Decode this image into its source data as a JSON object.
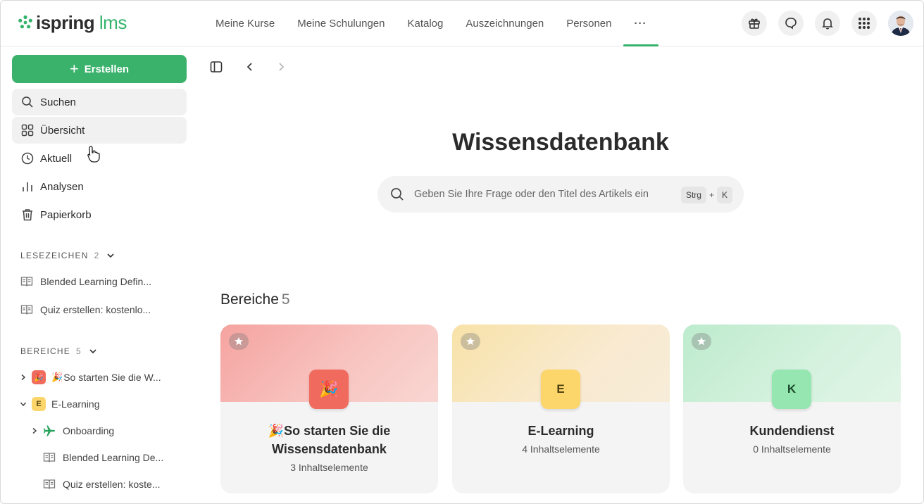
{
  "brand": {
    "name": "ispring",
    "suffix": "lms",
    "color": "#34b36b"
  },
  "nav": {
    "items": [
      {
        "label": "Meine Kurse"
      },
      {
        "label": "Meine Schulungen"
      },
      {
        "label": "Katalog"
      },
      {
        "label": "Auszeichnungen"
      },
      {
        "label": "Personen"
      },
      {
        "label": "···"
      }
    ]
  },
  "topicons": [
    "gift-icon",
    "chat-icon",
    "bell-icon",
    "apps-grid-icon",
    "user-avatar"
  ],
  "sidebar": {
    "create_label": "Erstellen",
    "items": [
      {
        "label": "Suchen",
        "icon": "search-icon"
      },
      {
        "label": "Übersicht",
        "icon": "grid-icon"
      },
      {
        "label": "Aktuell",
        "icon": "clock-icon"
      },
      {
        "label": "Analysen",
        "icon": "bar-chart-icon"
      },
      {
        "label": "Papierkorb",
        "icon": "trash-icon"
      }
    ],
    "bookmarks": {
      "label": "LESEZEICHEN",
      "count": "2",
      "items": [
        {
          "label": "Blended Learning Defin..."
        },
        {
          "label": "Quiz erstellen: kostenlo..."
        }
      ]
    },
    "areas": {
      "label": "BEREICHE",
      "count": "5",
      "items": [
        {
          "label": "So starten Sie die W...",
          "badge": "🎉"
        },
        {
          "label": "E-Learning",
          "badge": "E"
        },
        {
          "label": "Onboarding"
        },
        {
          "label": "Blended Learning De..."
        },
        {
          "label": "Quiz erstellen: koste..."
        }
      ]
    }
  },
  "main": {
    "title": "Wissensdatenbank",
    "search_placeholder": "Geben Sie Ihre Frage oder den Titel des Artikels ein",
    "shortcut": {
      "key1": "Strg",
      "plus": "+",
      "key2": "K"
    },
    "areas_title": "Bereiche",
    "areas_count": "5",
    "cards": [
      {
        "title_line1": "So starten Sie die",
        "title_line2": "Wissensdatenbank",
        "sub": "3 Inhaltselemente",
        "icon": "🎉",
        "color": "#f5a3a0",
        "icon_bg": "#f06a5e"
      },
      {
        "title": "E-Learning",
        "sub": "4 Inhaltselemente",
        "icon": "E",
        "color": "#f8e2a8",
        "icon_bg": "#fcd66a"
      },
      {
        "title": "Kundendienst",
        "sub": "0 Inhaltselemente",
        "icon": "K",
        "color": "#bdebcd",
        "icon_bg": "#95e6b0"
      }
    ]
  }
}
